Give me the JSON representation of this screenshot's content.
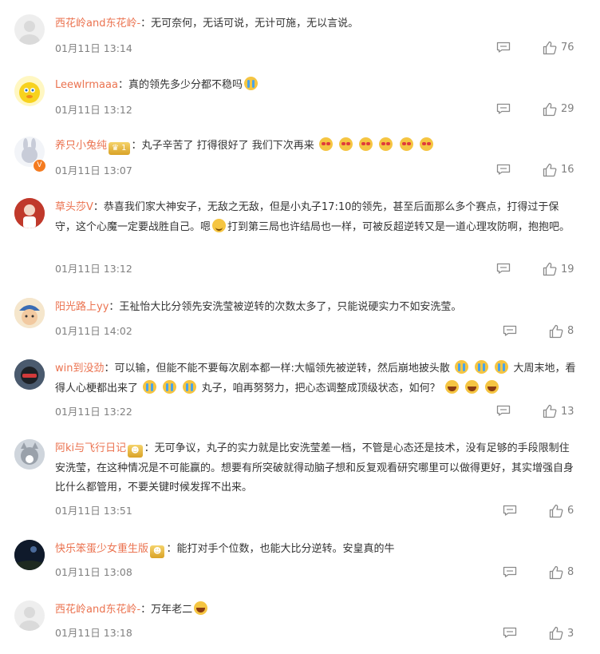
{
  "comments": [
    {
      "user": "西花岭and东花岭-",
      "text": "：无可奈何，无话可说，无计可施，无以言说。",
      "time": "01月11日 13:14",
      "likes": "76"
    },
    {
      "user": "Leewlrmaaa",
      "text": "：真的领先多少分都不稳吗",
      "time": "01月11日 13:12",
      "likes": "29"
    },
    {
      "user": "养只小兔纯",
      "badge": "1",
      "text": "：丸子辛苦了 打得很好了 我们下次再来",
      "time": "01月11日 13:07",
      "likes": "16"
    },
    {
      "user": "草头莎V",
      "text_a": "：恭喜我们家大神安子，无敌之无敌，但是小丸子17:10的领先，甚至后面那么多个赛点，打得过于保守，这个心魔一定要战胜自己。嗯",
      "text_b": "打到第三局也许结局也一样，可被反超逆转又是一道心理攻防啊，抱抱吧。",
      "time": "01月11日 13:12",
      "likes": "19"
    },
    {
      "user": "阳光路上yy",
      "text": "：王祉怡大比分领先安洗莹被逆转的次数太多了，只能说硬实力不如安洗莹。",
      "time": "01月11日 14:02",
      "likes": "8"
    },
    {
      "user": "win到没劲",
      "text_a": "：可以输，但能不能不要每次剧本都一样:大幅领先被逆转，然后崩地披头散",
      "text_b": "大周末地，看得人心梗都出来了",
      "text_c": "丸子，咱再努努力，把心态调整成顶级状态，如何？",
      "time": "01月11日 13:22",
      "likes": "13"
    },
    {
      "user": "阿ki与飞行日记",
      "text": "：无可争议，丸子的实力就是比安洗莹差一档，不管是心态还是技术，没有足够的手段限制住安洗莹，在这种情况是不可能赢的。想要有所突破就得动脑子想和反复观看研究哪里可以做得更好，其实增强自身比什么都管用，不要关键时候发挥不出来。",
      "time": "01月11日 13:51",
      "likes": "6"
    },
    {
      "user": "快乐笨蛋少女重生版",
      "text": "：能打对手个位数，也能大比分逆转。安皇真的牛",
      "time": "01月11日 13:08",
      "likes": "8"
    },
    {
      "user": "西花岭and东花岭-",
      "text": "：万年老二",
      "time": "01月11日 13:18",
      "likes": "3"
    }
  ]
}
